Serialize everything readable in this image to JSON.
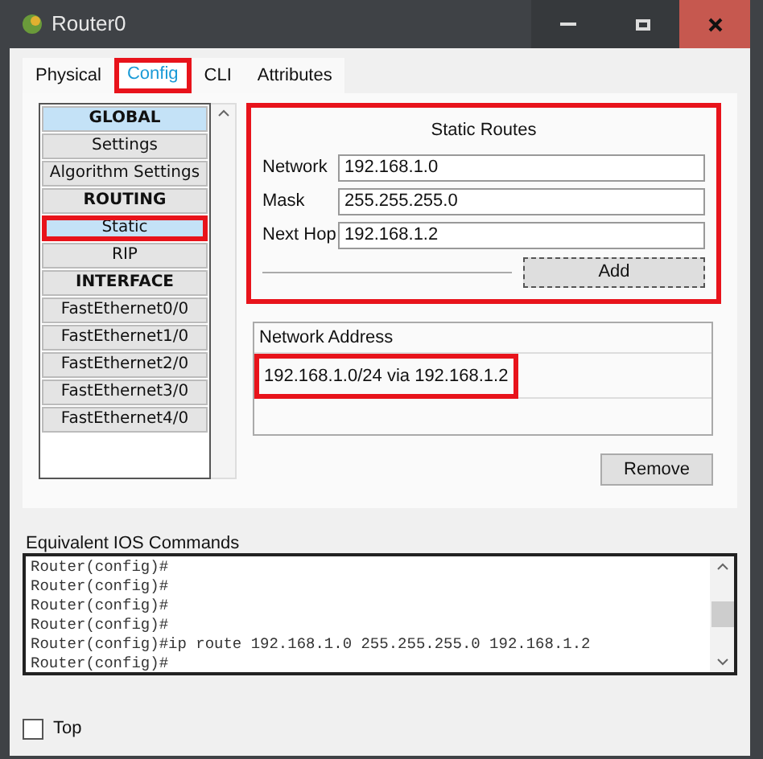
{
  "window": {
    "title": "Router0"
  },
  "tabs": [
    {
      "label": "Physical",
      "selected": false,
      "highlighted": false
    },
    {
      "label": "Config",
      "selected": true,
      "highlighted": true
    },
    {
      "label": "CLI",
      "selected": false,
      "highlighted": false
    },
    {
      "label": "Attributes",
      "selected": false,
      "highlighted": false
    }
  ],
  "sidebar": {
    "items": [
      {
        "kind": "header",
        "label": "GLOBAL",
        "selected": true,
        "highlighted": false
      },
      {
        "kind": "item",
        "label": "Settings",
        "selected": false,
        "highlighted": false
      },
      {
        "kind": "item",
        "label": "Algorithm Settings",
        "selected": false,
        "highlighted": false
      },
      {
        "kind": "header",
        "label": "ROUTING",
        "selected": false,
        "highlighted": false
      },
      {
        "kind": "item",
        "label": "Static",
        "selected": true,
        "highlighted": true
      },
      {
        "kind": "item",
        "label": "RIP",
        "selected": false,
        "highlighted": false
      },
      {
        "kind": "header",
        "label": "INTERFACE",
        "selected": false,
        "highlighted": false
      },
      {
        "kind": "item",
        "label": "FastEthernet0/0",
        "selected": false,
        "highlighted": false
      },
      {
        "kind": "item",
        "label": "FastEthernet1/0",
        "selected": false,
        "highlighted": false
      },
      {
        "kind": "item",
        "label": "FastEthernet2/0",
        "selected": false,
        "highlighted": false
      },
      {
        "kind": "item",
        "label": "FastEthernet3/0",
        "selected": false,
        "highlighted": false
      },
      {
        "kind": "item",
        "label": "FastEthernet4/0",
        "selected": false,
        "highlighted": false
      }
    ]
  },
  "static_routes": {
    "title": "Static Routes",
    "highlighted": true,
    "fields": [
      {
        "label": "Network",
        "value": "192.168.1.0"
      },
      {
        "label": "Mask",
        "value": "255.255.255.0"
      },
      {
        "label": "Next Hop",
        "value": "192.168.1.2"
      }
    ],
    "add_button": "Add"
  },
  "routes_list": {
    "header": "Network Address",
    "rows": [
      {
        "text": "192.168.1.0/24 via 192.168.1.2",
        "highlighted": true
      }
    ],
    "remove_button": "Remove"
  },
  "ios_commands": {
    "label": "Equivalent IOS Commands",
    "lines": [
      "Router(config)#",
      "Router(config)#",
      "Router(config)#",
      "Router(config)#",
      "Router(config)#ip route 192.168.1.0 255.255.255.0 192.168.1.2",
      "Router(config)#"
    ]
  },
  "top_checkbox": {
    "label": "Top",
    "checked": false
  }
}
